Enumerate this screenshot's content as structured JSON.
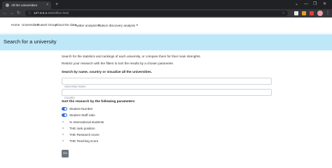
{
  "browser": {
    "tab_title": "All the universities",
    "tab_close": "×",
    "new_tab": "+",
    "url_host": "127.0.0.1",
    "url_path": ":5000/filter.html",
    "window_controls": [
      "⌄",
      "—",
      "❐",
      "✕"
    ],
    "icons": [
      "back-arrow-icon",
      "forward-arrow-icon",
      "reload-icon",
      "info-icon",
      "star-icon",
      "kebab-menu-icon"
    ]
  },
  "navbar": {
    "items": [
      {
        "label": "Home"
      },
      {
        "label": "Universities"
      },
      {
        "label": "Russel Group"
      },
      {
        "label": "About the data"
      },
      {
        "label": "Twitter analysis",
        "dropdown": true
      },
      {
        "label": "Watson discovery analysis",
        "dropdown": true
      }
    ]
  },
  "jumbotron": {
    "title": "Search for a university"
  },
  "intro": {
    "line1": "Search for the statistics and rankings of each university, or compare them for their main strenghts.",
    "line2": "Restrict your research with the filters to sort the results by a chosen parameter."
  },
  "search": {
    "heading": "Search by name, country or visualize all the universities.",
    "name_placeholder": "University Name",
    "country_placeholder": "Country"
  },
  "sort": {
    "heading": "Sort the research by the following parameters",
    "options": [
      {
        "label": "Student Number",
        "checked": true
      },
      {
        "label": "Student Staff ratio",
        "checked": true
      },
      {
        "label": "% International students",
        "checked": false
      },
      {
        "label": "THE rank position",
        "checked": false
      },
      {
        "label": "THE Research score",
        "checked": false
      },
      {
        "label": "THE Teaching score",
        "checked": false
      }
    ]
  },
  "go_label": "GO",
  "colors": {
    "jumbotron": "#bee8f7",
    "switch_on": "#2f6fe0",
    "button": "#6c757d",
    "chrome_dark": "#202124"
  }
}
